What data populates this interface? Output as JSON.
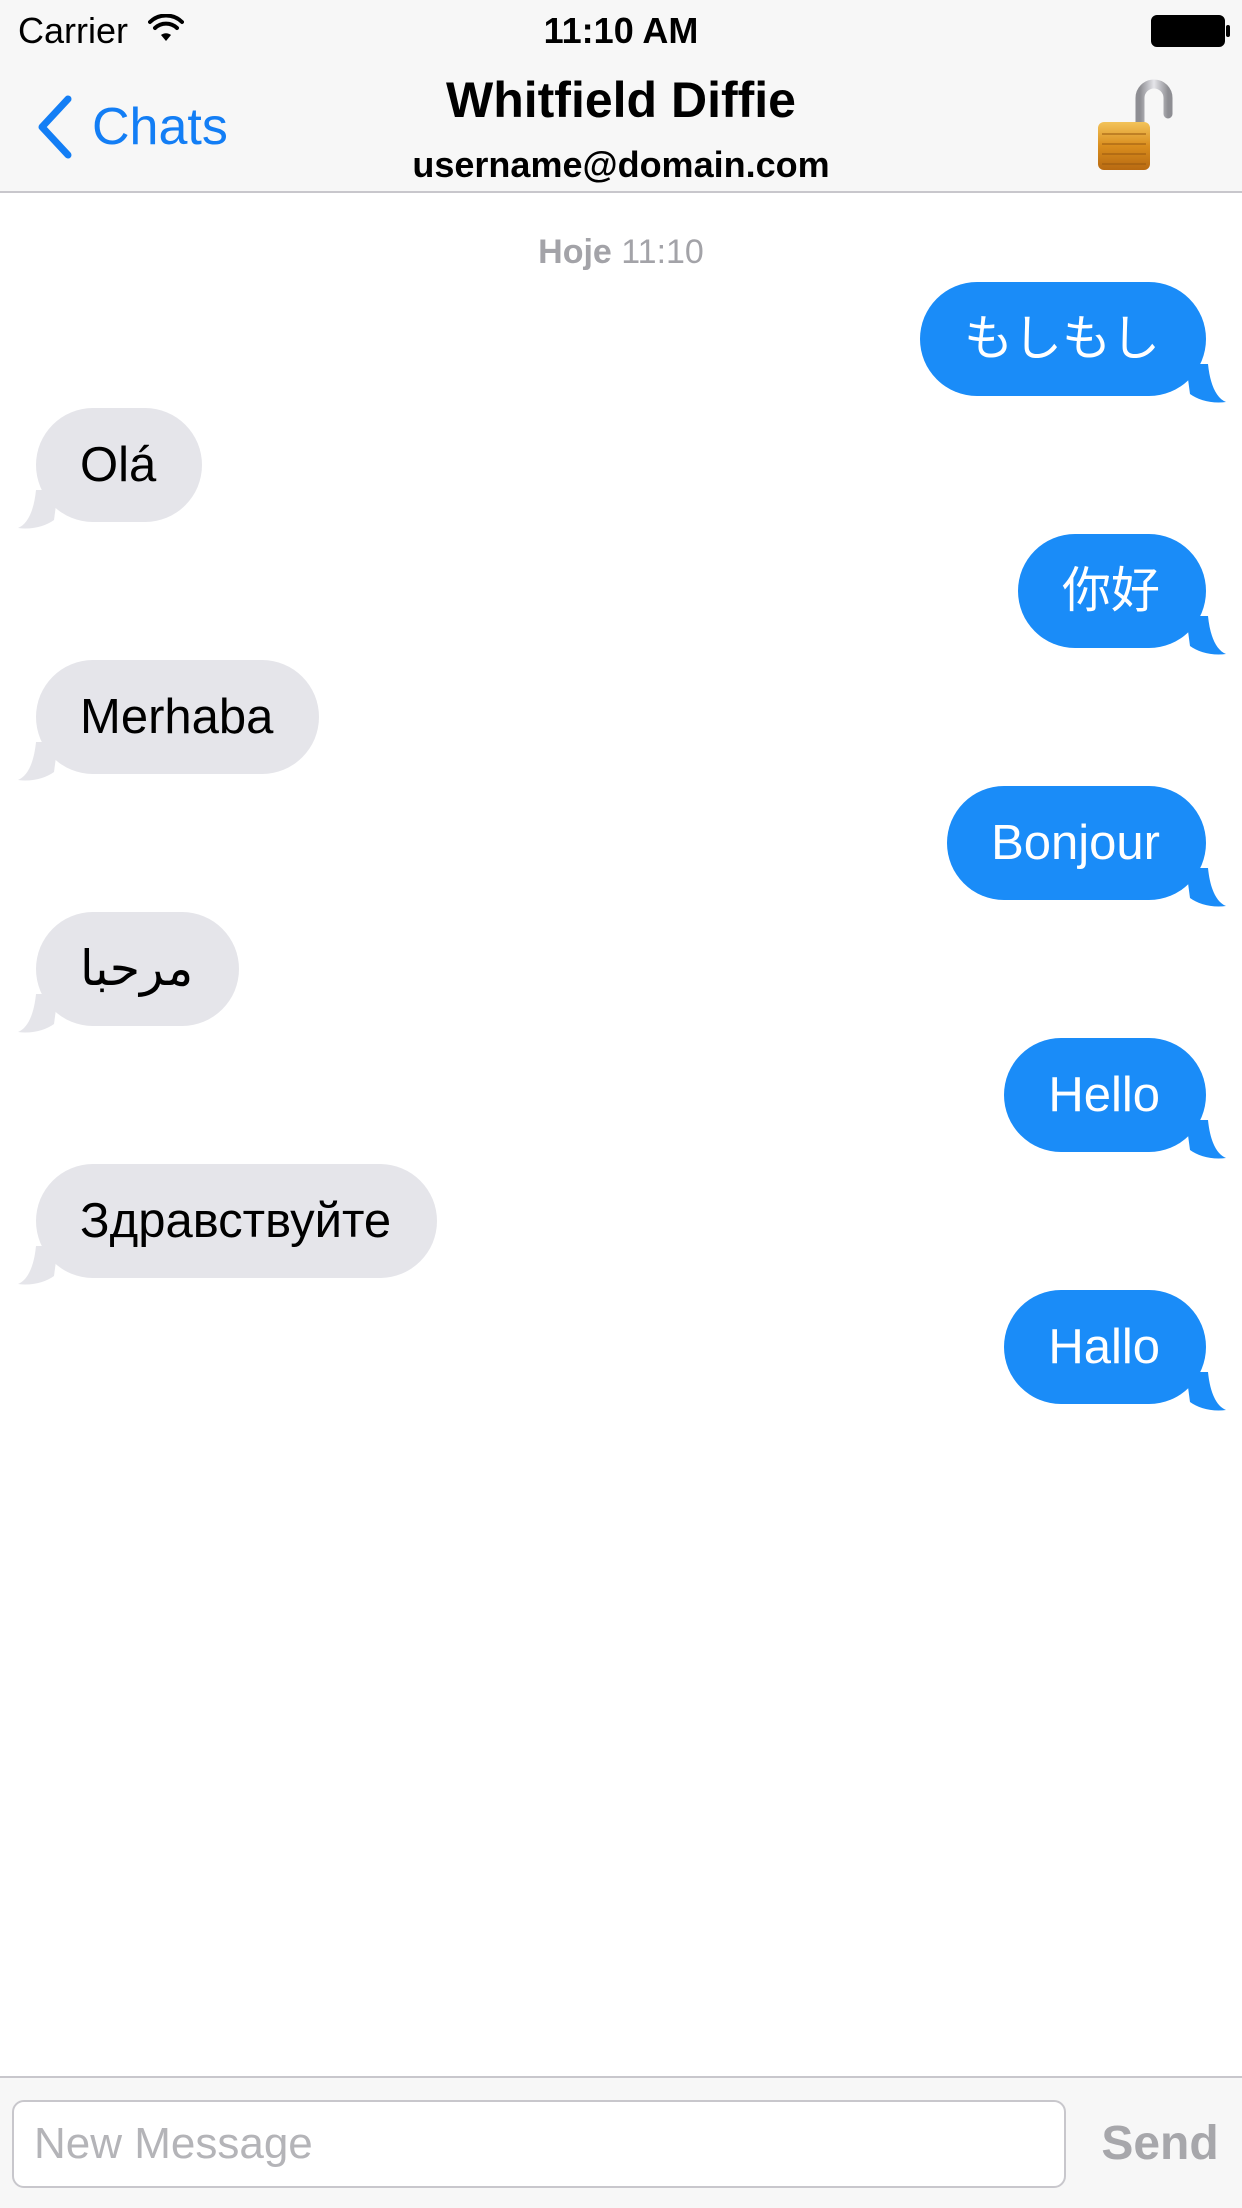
{
  "status_bar": {
    "carrier": "Carrier",
    "time": "11:10 AM"
  },
  "nav": {
    "back_label": "Chats",
    "title": "Whitfield Diffie",
    "subtitle": "username@domain.com",
    "lock_icon": "open-padlock-icon"
  },
  "chat": {
    "timestamp_day": "Hoje",
    "timestamp_time": "11:10",
    "messages": [
      {
        "direction": "out",
        "text": "もしもし"
      },
      {
        "direction": "in",
        "text": "Olá"
      },
      {
        "direction": "out",
        "text": "你好"
      },
      {
        "direction": "in",
        "text": "Merhaba"
      },
      {
        "direction": "out",
        "text": "Bonjour"
      },
      {
        "direction": "in",
        "text": "مرحبا"
      },
      {
        "direction": "out",
        "text": "Hello"
      },
      {
        "direction": "in",
        "text": "Здравствуйте"
      },
      {
        "direction": "out",
        "text": "Hallo"
      }
    ]
  },
  "composer": {
    "placeholder": "New Message",
    "send_label": "Send"
  },
  "colors": {
    "accent": "#137ef5",
    "outgoing_bubble": "#1a8cf8",
    "incoming_bubble": "#e5e5ea"
  }
}
